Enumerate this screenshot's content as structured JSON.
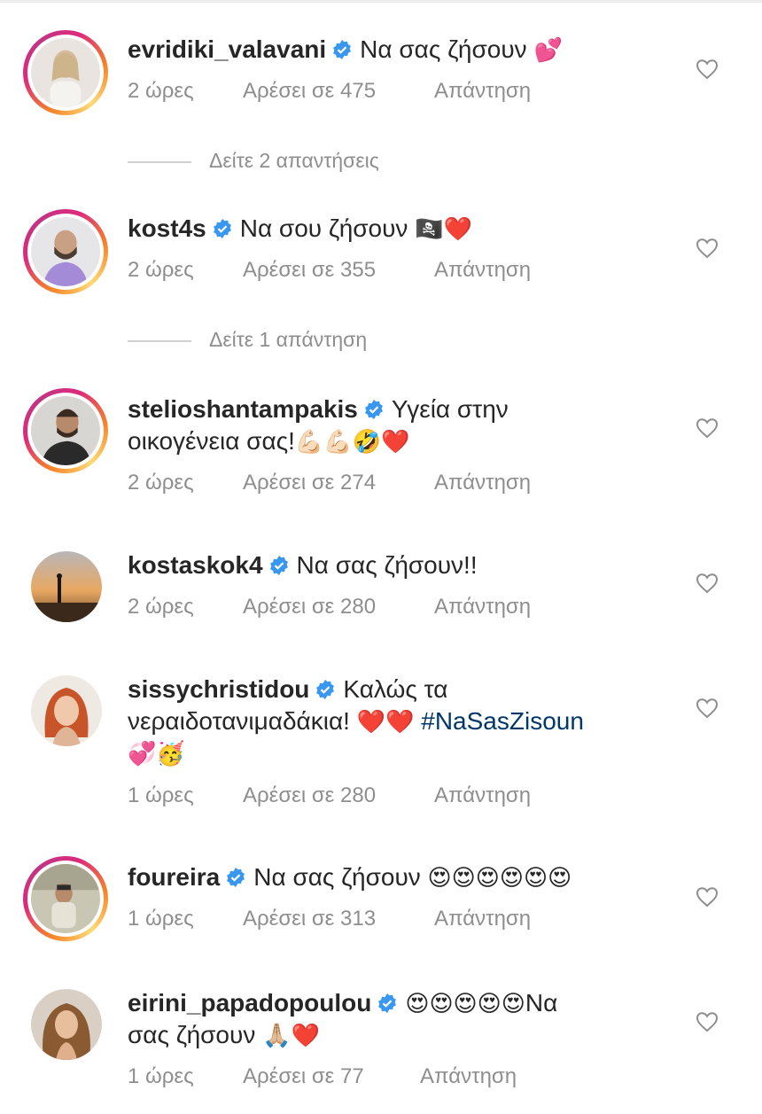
{
  "comments": [
    {
      "username": "evridiki_valavani",
      "text": "Να σας ζήσουν",
      "emoji": "💕",
      "time": "2 ώρες",
      "likes": "Αρέσει σε 475",
      "reply": "Απάντηση",
      "view_replies": "Δείτε 2 απαντήσεις"
    },
    {
      "username": "kost4s",
      "text": "Να σου ζήσουν",
      "emoji": "🏴‍☠️❤️",
      "time": "2 ώρες",
      "likes": "Αρέσει σε 355",
      "reply": "Απάντηση",
      "view_replies": "Δείτε 1 απάντηση"
    },
    {
      "username": "stelioshantampakis",
      "text_line1": "Υγεία στην",
      "text_line2": "οικογένεια σας!",
      "emoji": "💪🏻💪🏻🤣❤️",
      "time": "2 ώρες",
      "likes": "Αρέσει σε 274",
      "reply": "Απάντηση"
    },
    {
      "username": "kostaskok4",
      "text": "Να σας ζήσουν!!",
      "time": "2 ώρες",
      "likes": "Αρέσει σε 280",
      "reply": "Απάντηση"
    },
    {
      "username": "sissychristidou",
      "text_line1": "Καλώς τα",
      "text_line2": "νεραιδοτανιμαδάκια!",
      "emoji_mid": "❤️❤️",
      "hashtag": "#NaSasZisoun",
      "emoji_line3": "💞🥳",
      "time": "1 ώρες",
      "likes": "Αρέσει σε 280",
      "reply": "Απάντηση"
    },
    {
      "username": "foureira",
      "text": "Να σας ζήσουν",
      "emoji": "😍😍😍😍😍😍",
      "time": "1 ώρες",
      "likes": "Αρέσει σε 313",
      "reply": "Απάντηση"
    },
    {
      "username": "eirini_papadopoulou",
      "emoji_line1": "😍😍😍😍😍",
      "text_line1": "Να",
      "text_line2": "σας ζήσουν",
      "emoji_line2": "🙏🏼❤️",
      "time": "1 ώρες",
      "likes": "Αρέσει σε 77",
      "reply": "Απάντηση"
    }
  ],
  "colors": {
    "username": "#262626",
    "meta": "#8e8e8e",
    "verified": "#3897f0",
    "hashtag": "#00376b"
  },
  "icons": {
    "verified": "verified-badge-icon",
    "like": "heart-outline-icon"
  }
}
